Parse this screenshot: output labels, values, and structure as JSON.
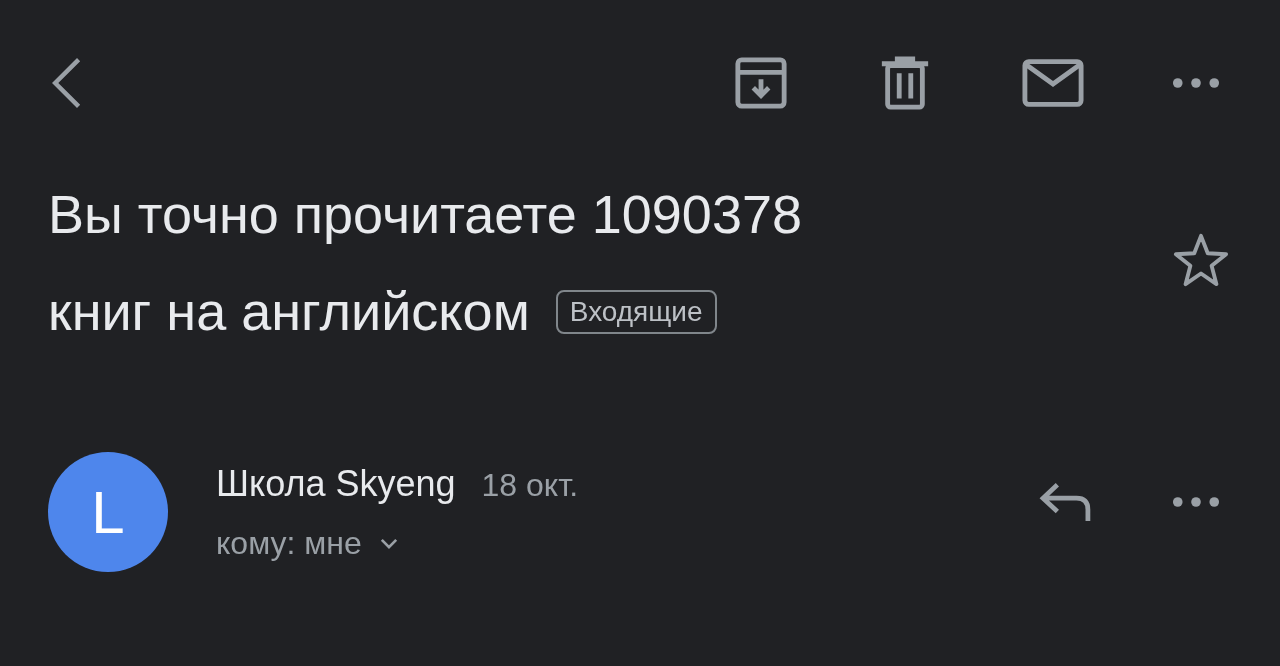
{
  "title": {
    "lines": [
      "Вы точно прочитаете 1090378",
      "книг на английском"
    ],
    "label": "Входящие",
    "starred": false
  },
  "message": {
    "avatar": {
      "letter": "L",
      "color": "#4e86ec"
    },
    "sender": "Школа Skyeng",
    "date": "18 окт.",
    "recipient": "кому: мне"
  }
}
